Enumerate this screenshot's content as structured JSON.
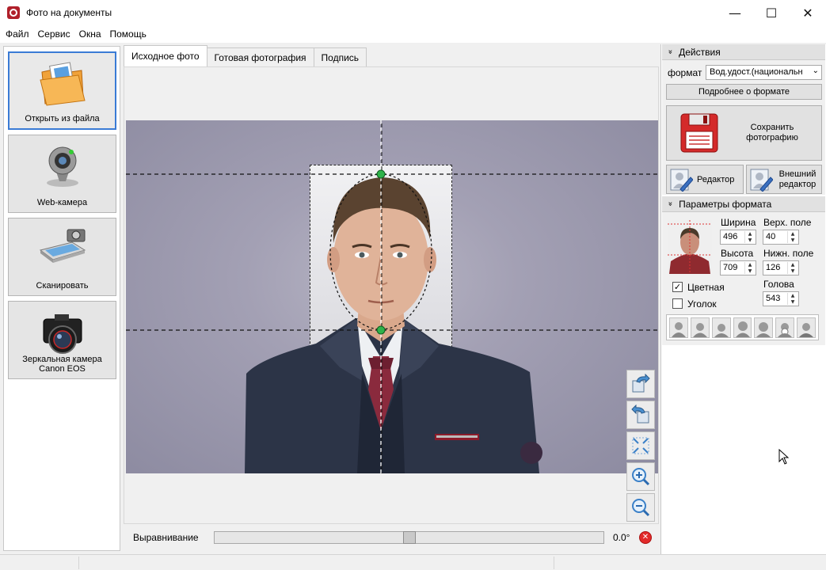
{
  "window": {
    "title": "Фото на документы"
  },
  "window_controls": {
    "minimize": "—",
    "maximize": "☐",
    "close": "✕"
  },
  "menu": [
    "Файл",
    "Сервис",
    "Окна",
    "Помощь"
  ],
  "sources": [
    {
      "label": "Открыть из файла",
      "icon": "folder-icon"
    },
    {
      "label": "Web-камера",
      "icon": "webcam-icon"
    },
    {
      "label": "Сканировать",
      "icon": "scanner-icon"
    },
    {
      "label": "Зеркальная камера Canon EOS",
      "icon": "dslr-camera-icon"
    }
  ],
  "tabs": [
    "Исходное фото",
    "Готовая фотография",
    "Подпись"
  ],
  "alignment": {
    "label": "Выравнивание",
    "value": "0.0°",
    "slider_fraction": 0.5
  },
  "actions": {
    "header": "Действия",
    "format_label": "формат",
    "format_value": "Вод.удост.(национальн",
    "format_details": "Подробнее о формате",
    "save_label": "Сохранить фотографию",
    "editor_label": "Редактор",
    "external_editor_label": "Внешний редактор"
  },
  "format_params": {
    "header": "Параметры формата",
    "width_label": "Ширина",
    "width": "496",
    "top_margin_label": "Верх. поле",
    "top_margin": "40",
    "height_label": "Высота",
    "height": "709",
    "bottom_margin_label": "Нижн. поле",
    "bottom_margin": "126",
    "color_label": "Цветная",
    "color_checked": true,
    "corner_label": "Уголок",
    "corner_checked": false,
    "head_label": "Голова",
    "head": "543"
  },
  "colors": {
    "active_border": "#3a7bd5",
    "save_icon": "#d42a2a",
    "guide_green": "#2fb34a"
  }
}
